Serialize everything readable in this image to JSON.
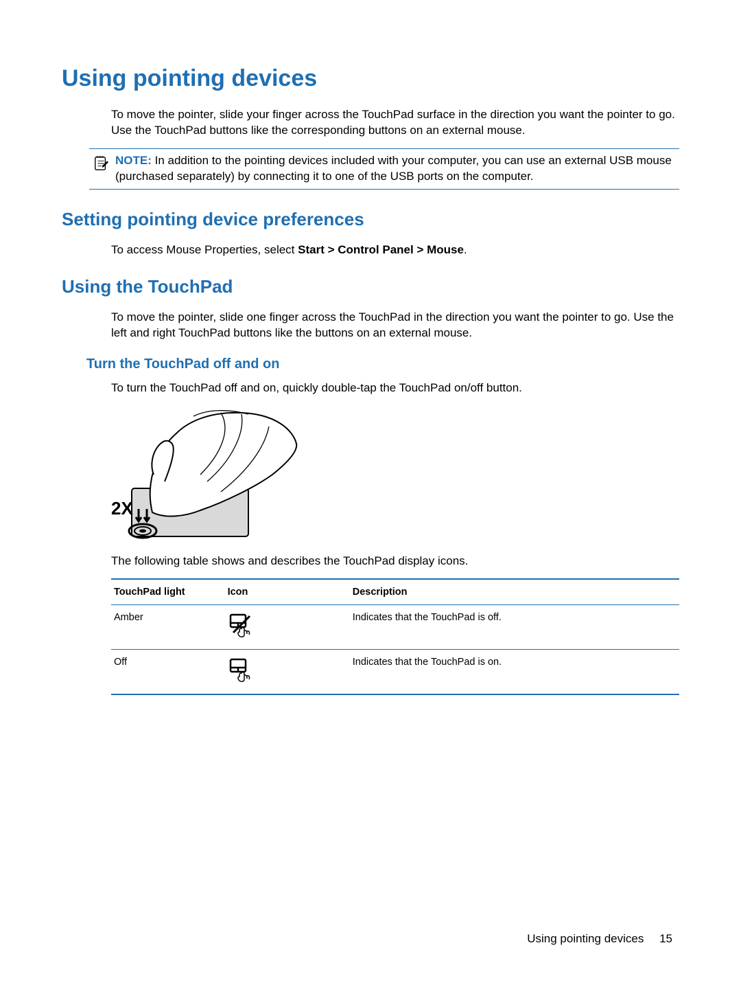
{
  "h1": "Using pointing devices",
  "intro_p1": "To move the pointer, slide your finger across the TouchPad surface in the direction you want the pointer to go. Use the TouchPad buttons like the corresponding buttons on an external mouse.",
  "note": {
    "label": "NOTE:",
    "text": "In addition to the pointing devices included with your computer, you can use an external USB mouse (purchased separately) by connecting it to one of the USB ports on the computer."
  },
  "sec1": {
    "h2": "Setting pointing device preferences",
    "p_prefix": "To access Mouse Properties, select ",
    "p_bold": "Start > Control Panel > Mouse",
    "p_suffix": "."
  },
  "sec2": {
    "h2": "Using the TouchPad",
    "p1": "To move the pointer, slide one finger across the TouchPad in the direction you want the pointer to go. Use the left and right TouchPad buttons like the buttons on an external mouse.",
    "h3": "Turn the TouchPad off and on",
    "p2": "To turn the TouchPad off and on, quickly double-tap the TouchPad on/off button.",
    "p3": "The following table shows and describes the TouchPad display icons."
  },
  "table": {
    "headers": {
      "c1": "TouchPad light",
      "c2": "Icon",
      "c3": "Description"
    },
    "rows": [
      {
        "light": "Amber",
        "icon": "touchpad-off-icon",
        "desc": "Indicates that the TouchPad is off."
      },
      {
        "light": "Off",
        "icon": "touchpad-on-icon",
        "desc": "Indicates that the TouchPad is on."
      }
    ]
  },
  "footer": {
    "section": "Using pointing devices",
    "page": "15"
  },
  "illustration_label": "2X"
}
